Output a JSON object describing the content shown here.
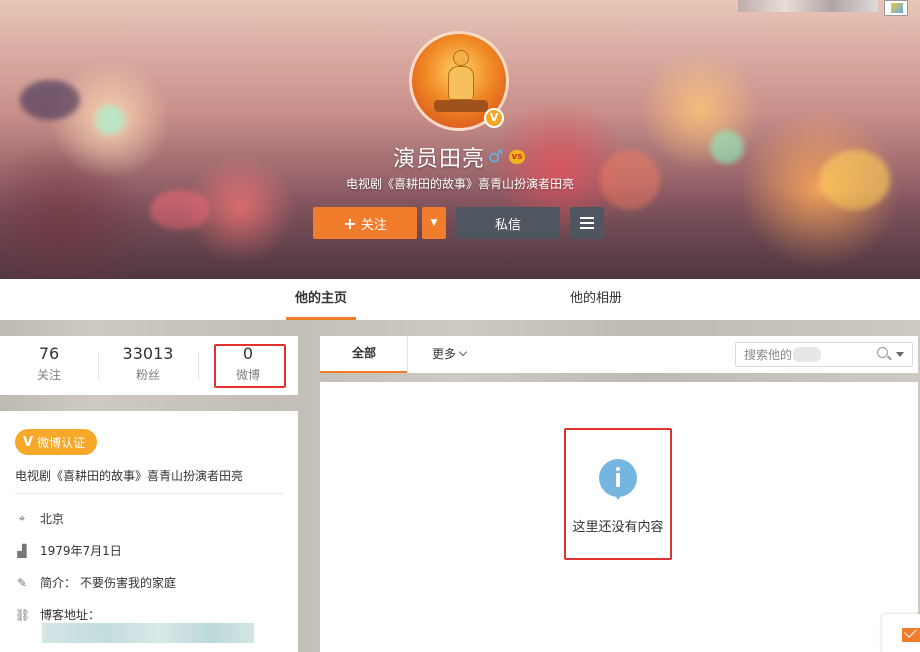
{
  "profile": {
    "name": "演员田亮",
    "bio": "电视剧《喜耕田的故事》喜青山扮演者田亮",
    "level_badge": "vs",
    "verified_mark": "V"
  },
  "actions": {
    "follow_plus": "+",
    "follow_label": "关注",
    "message_label": "私信"
  },
  "tabs": {
    "home": "他的主页",
    "album": "他的相册"
  },
  "stats": {
    "following": {
      "count": "76",
      "label": "关注"
    },
    "fans": {
      "count": "33013",
      "label": "粉丝"
    },
    "weibo": {
      "count": "0",
      "label": "微博"
    }
  },
  "info": {
    "verify_badge": "微博认证",
    "verify_mark": "V",
    "verify_desc": "电视剧《喜耕田的故事》喜青山扮演者田亮",
    "location": "北京",
    "birthday": "1979年7月1日",
    "intro_label": "简介：",
    "intro_value": "不要伤害我的家庭",
    "blog_label": "博客地址："
  },
  "feed": {
    "tab_all": "全部",
    "tab_more": "更多",
    "search_placeholder": "搜索他的",
    "empty_text": "这里还没有内容"
  },
  "colors": {
    "accent": "#f07c2c",
    "dark_button": "#4f5660",
    "highlight_border": "#e03131",
    "info_icon": "#74b6e0",
    "verify_badge": "#f7a829"
  },
  "icons": [
    "male-icon",
    "level-icon",
    "verified-icon",
    "chevron-down-icon",
    "menu-icon",
    "location-icon",
    "birthday-icon",
    "intro-icon",
    "link-icon",
    "search-icon",
    "info-icon",
    "mail-icon"
  ]
}
